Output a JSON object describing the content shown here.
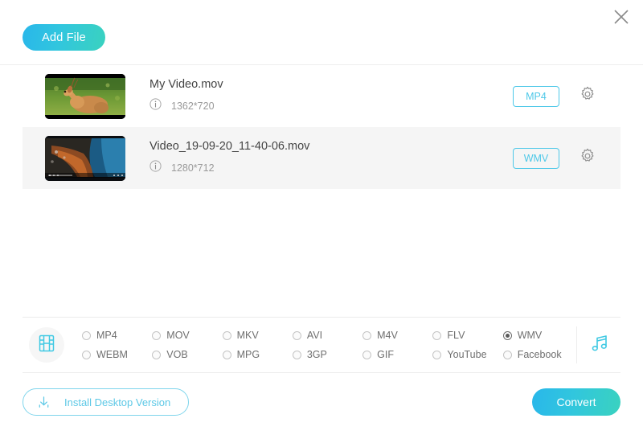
{
  "window": {
    "close_label": "✕",
    "close_icon": "close-icon"
  },
  "toolbar": {
    "add_file_label": "Add File"
  },
  "files": [
    {
      "name": "My Video.mov",
      "resolution": "1362*720",
      "format": "MP4",
      "info_icon": "info-icon",
      "settings_icon": "gear-icon",
      "thumbnail": "deer-in-grass",
      "highlighted": false
    },
    {
      "name": "Video_19-09-20_11-40-06.mov",
      "resolution": "1280*712",
      "format": "WMV",
      "info_icon": "info-icon",
      "settings_icon": "gear-icon",
      "thumbnail": "aerial-coastline",
      "highlighted": true
    }
  ],
  "formats_panel": {
    "video_icon": "film-strip-icon",
    "audio_icon": "music-note-icon",
    "selected": "WMV",
    "options": [
      {
        "label": "MP4",
        "selected": false
      },
      {
        "label": "MOV",
        "selected": false
      },
      {
        "label": "MKV",
        "selected": false
      },
      {
        "label": "AVI",
        "selected": false
      },
      {
        "label": "M4V",
        "selected": false
      },
      {
        "label": "FLV",
        "selected": false
      },
      {
        "label": "WMV",
        "selected": true
      },
      {
        "label": "WEBM",
        "selected": false
      },
      {
        "label": "VOB",
        "selected": false
      },
      {
        "label": "MPG",
        "selected": false
      },
      {
        "label": "3GP",
        "selected": false
      },
      {
        "label": "GIF",
        "selected": false
      },
      {
        "label": "YouTube",
        "selected": false
      },
      {
        "label": "Facebook",
        "selected": false
      }
    ]
  },
  "footer": {
    "install_label": "Install Desktop Version",
    "install_icon": "download-icon",
    "convert_label": "Convert"
  },
  "colors": {
    "accent_cyan": "#4ec8e8",
    "gradient_start": "#29b7ea",
    "gradient_end": "#3ad2bf",
    "row_highlight": "#f5f5f5",
    "text_primary": "#444444",
    "text_muted": "#9a9a9a"
  }
}
